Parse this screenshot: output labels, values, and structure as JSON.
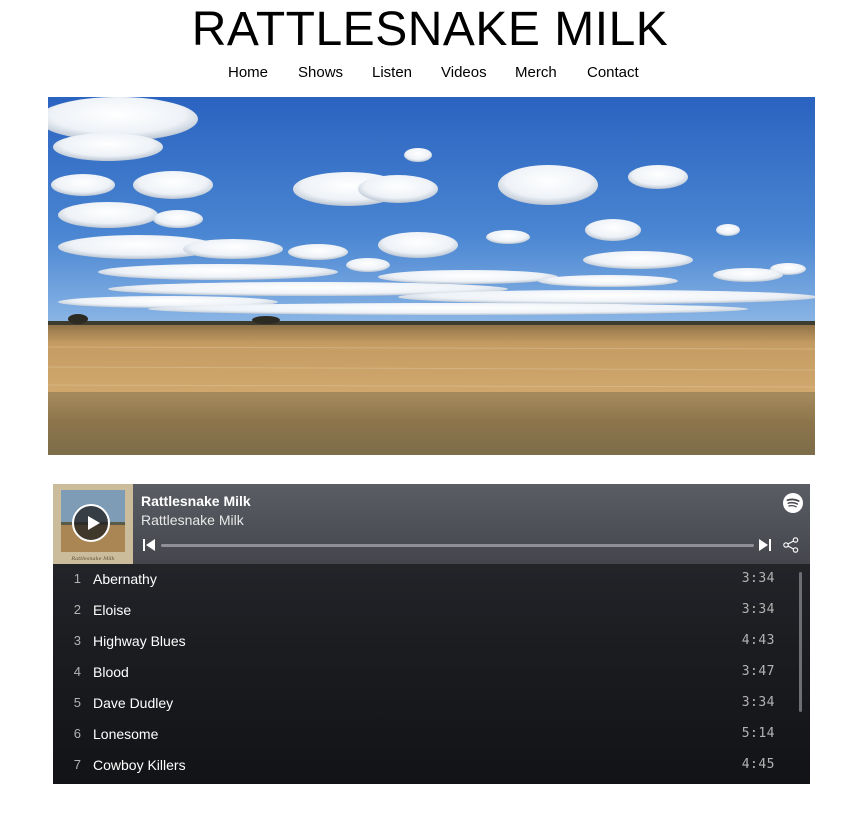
{
  "site": {
    "title": "RATTLESNAKE MILK"
  },
  "nav": {
    "items": [
      "Home",
      "Shows",
      "Listen",
      "Videos",
      "Merch",
      "Contact"
    ]
  },
  "hero": {
    "description_icon": "prairie-landscape-image"
  },
  "player": {
    "album_title": "Rattlesnake Milk",
    "artist": "Rattlesnake Milk",
    "cover_caption": "Rattlesnake Milk",
    "progress": 0,
    "icons": {
      "brand": "spotify-icon",
      "share": "share-icon",
      "prev": "skip-back-icon",
      "next": "skip-forward-icon",
      "play": "play-icon"
    },
    "tracks": [
      {
        "num": "1",
        "name": "Abernathy",
        "duration": "3:34"
      },
      {
        "num": "2",
        "name": "Eloise",
        "duration": "3:34"
      },
      {
        "num": "3",
        "name": "Highway Blues",
        "duration": "4:43"
      },
      {
        "num": "4",
        "name": "Blood",
        "duration": "3:47"
      },
      {
        "num": "5",
        "name": "Dave Dudley",
        "duration": "3:34"
      },
      {
        "num": "6",
        "name": "Lonesome",
        "duration": "5:14"
      },
      {
        "num": "7",
        "name": "Cowboy Killers",
        "duration": "4:45"
      }
    ]
  },
  "colors": {
    "sky": "#2f6fc8",
    "field": "#b98f52",
    "player_bg": "#1b1c20"
  }
}
